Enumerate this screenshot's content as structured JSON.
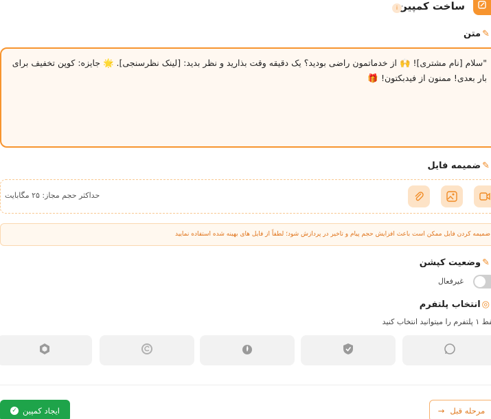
{
  "header": {
    "title": "ساخت کمپین",
    "badge": "i"
  },
  "message": {
    "label": "متن",
    "text": "\"سلام [نام مشتری]! 🙌 از خدماتمون راضی بودید؟ یک دقیقه وقت بذارید و نظر بدید: [لینک نظرسنجی]. 🌟 جایزه: کوپن تخفیف برای بار بعدی! ممنون از فیدبکتون! 🎁"
  },
  "attachment": {
    "label": "ضمیمه فایل",
    "hint": "حداکثر حجم مجاز: ۲۵ مگابایت",
    "buttons": [
      "video-icon",
      "image-icon",
      "paperclip-icon"
    ],
    "warning": "ضمیمه کردن فایل ممکن است باعث افزایش حجم پیام و تاخیر در پردازش شود؛ لطفاً از فایل های بهینه شده استفاده نمایید"
  },
  "caption": {
    "label": "وضعیت کپشن",
    "toggle_label": "غیرفعال"
  },
  "platform": {
    "label": "انتخاب پلتفرم",
    "hint": "فقط ۱ پلتفرم را میتوانید انتخاب کنید",
    "options": [
      "whatsapp-icon",
      "check-shield-icon",
      "flame-icon",
      "circle-e-icon",
      "hexagon-icon"
    ]
  },
  "footer": {
    "create_label": "ایجاد کمپین",
    "prev_label": "مرحله قبل"
  },
  "colors": {
    "accent": "#f7942e",
    "success": "#1ea44a"
  }
}
